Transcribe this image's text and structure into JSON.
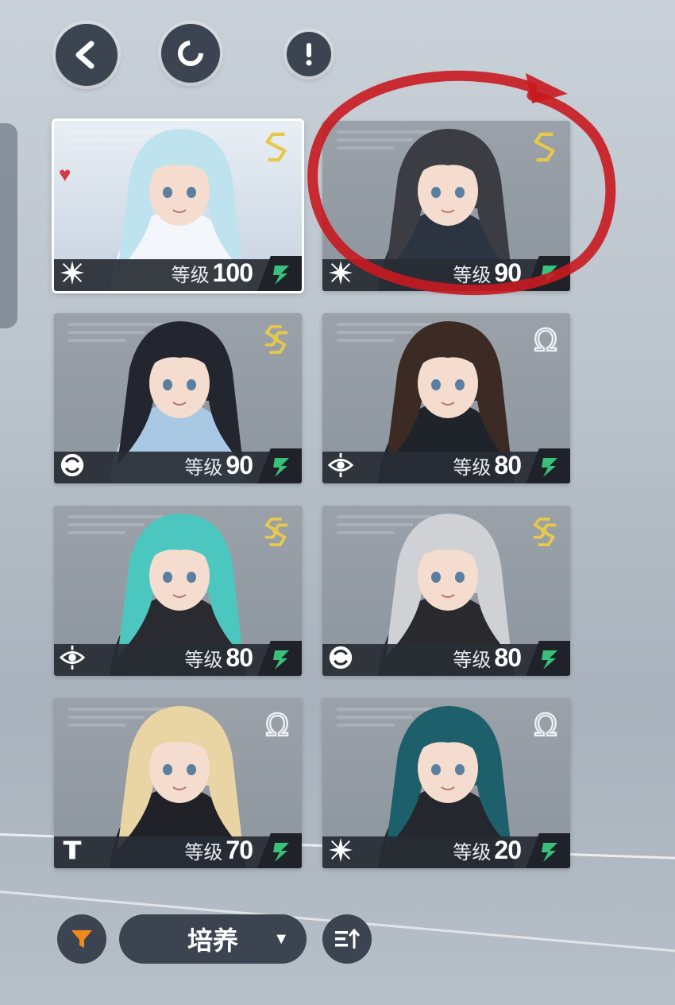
{
  "level_label": "等级",
  "colors": {
    "panel": "#3b4450",
    "bar": "#2a2e35",
    "gold": "#e6c84a",
    "silver": "#dfe6ec",
    "green": "#39c07a",
    "annotation": "#c8191f",
    "heart": "#d43a46"
  },
  "top_buttons": [
    {
      "name": "back-button",
      "icon": "chevron-left-icon"
    },
    {
      "name": "refresh-button",
      "icon": "ring-icon"
    },
    {
      "name": "info-button",
      "icon": "exclamation-icon"
    }
  ],
  "cards": [
    {
      "level": "100",
      "rank": "S",
      "class_icon": "star-icon",
      "favorite": true,
      "selected": true,
      "hair": "#bfe3ee",
      "outfit": "#f3f6fa"
    },
    {
      "level": "90",
      "rank": "S",
      "class_icon": "star-icon",
      "favorite": false,
      "selected": false,
      "hair": "#3b3d42",
      "outfit": "#2c3442"
    },
    {
      "level": "90",
      "rank": "SS",
      "class_icon": "cycle-icon",
      "favorite": false,
      "selected": false,
      "hair": "#23262f",
      "outfit": "#a8c8e4"
    },
    {
      "level": "80",
      "rank": "Ω",
      "class_icon": "eye-icon",
      "favorite": false,
      "selected": false,
      "hair": "#3c2a24",
      "outfit": "#1e2429"
    },
    {
      "level": "80",
      "rank": "SS",
      "class_icon": "eye-icon",
      "favorite": false,
      "selected": false,
      "hair": "#4cc7c0",
      "outfit": "#2a2b30"
    },
    {
      "level": "80",
      "rank": "SS",
      "class_icon": "cycle-icon",
      "favorite": false,
      "selected": false,
      "hair": "#cfd1d4",
      "outfit": "#2a2a2e"
    },
    {
      "level": "70",
      "rank": "Ω",
      "class_icon": "pillar-icon",
      "favorite": false,
      "selected": false,
      "hair": "#e9d4a4",
      "outfit": "#202227"
    },
    {
      "level": "20",
      "rank": "Ω",
      "class_icon": "star-icon",
      "favorite": false,
      "selected": false,
      "hair": "#1d5f6a",
      "outfit": "#24272d"
    }
  ],
  "bottom": {
    "filter_icon": "funnel-icon",
    "dropdown_label": "培养",
    "sort_icon": "sort-icon"
  }
}
